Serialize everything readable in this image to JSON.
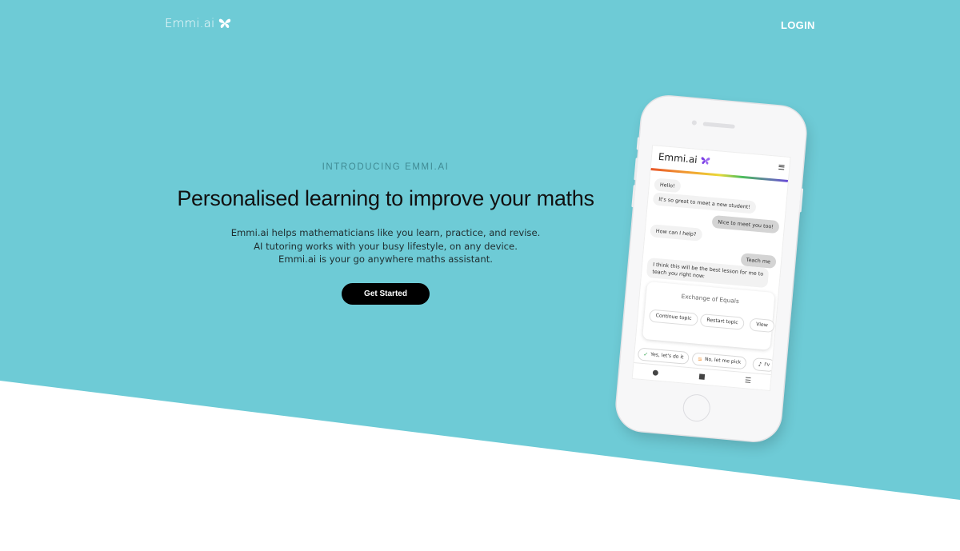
{
  "nav": {
    "brand": "Emmi.ai",
    "login": "LOGIN"
  },
  "hero": {
    "eyebrow": "INTRODUCING EMMI.AI",
    "headline": "Personalised learning to improve your maths",
    "description": [
      "Emmi.ai helps mathematicians like you learn, practice, and revise.",
      "AI tutoring works with your busy lifestyle, on any device.",
      "Emmi.ai is your go anywhere maths assistant."
    ],
    "cta": "Get Started"
  },
  "phone": {
    "app_logo": "Emmi.ai",
    "messages": [
      {
        "from": "bot",
        "text": "Hello!"
      },
      {
        "from": "bot",
        "text": "It's so great to meet a new student!"
      },
      {
        "from": "user",
        "text": "Nice to meet you too!"
      },
      {
        "from": "bot",
        "text": "How can I help?"
      },
      {
        "from": "user",
        "text": "Teach me"
      },
      {
        "from": "bot",
        "text": "I think this will be the best lesson for me to"
      },
      {
        "from": "bot",
        "text": "teach you right now:"
      }
    ],
    "topic_card": {
      "title": "Exchange of Equals",
      "actions": [
        "Continue topic",
        "Restart topic",
        "View"
      ]
    },
    "quick_replies": [
      {
        "icon": "check-icon",
        "label": "Yes, let's do it"
      },
      {
        "icon": "list-icon",
        "label": "No, let me pick"
      },
      {
        "icon": "music-note-icon",
        "label": "I'v"
      }
    ],
    "tabs": [
      "help-icon",
      "chat-icon",
      "list-icon"
    ]
  },
  "colors": {
    "hero_background": "#6ecbd6",
    "cta_background": "#000000",
    "eyebrow": "#3f8a93",
    "brand_butterfly": "#7b3fe4"
  }
}
